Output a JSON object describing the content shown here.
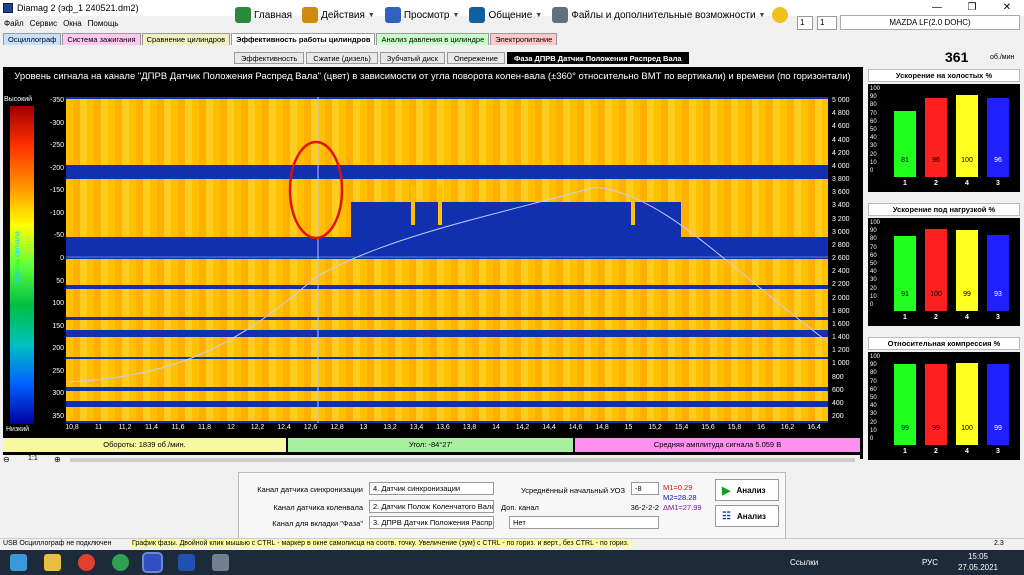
{
  "window": {
    "title": "Diamag 2 (эф_1 240521.dm2)"
  },
  "menu": [
    "Файл",
    "Сервис",
    "Окна",
    "Помощь"
  ],
  "toolbar": {
    "home": "Главная",
    "actions": "Действия",
    "view": "Просмотр",
    "comm": "Общение",
    "files": "Файлы и дополнительные возможности"
  },
  "spinners": {
    "a": "1",
    "b": "1"
  },
  "car": "MAZDA LF(2.0 DOHC)",
  "tabs": [
    "Осциллограф",
    "Система зажигания",
    "Сравнение цилиндров",
    "Эффективность работы цилиндров",
    "Анализ давления в цилиндре",
    "Электропитание"
  ],
  "subtabs": [
    "Эффективность",
    "Сжатие (дизель)",
    "Зубчатый диск",
    "Опережение",
    "Фаза ДПРВ Датчик Положения Распред Вала"
  ],
  "rpm": {
    "value": "361",
    "unit": "об./мин"
  },
  "plot": {
    "title": "Уровень сигнала на канале \"ДПРВ Датчик Положения Распред Вала\" (цвет) в зависимости от угла поворота колен-вала (±360° относительно ВМТ по вертикали) и времени (по горизонтали)",
    "colorbar_top": "Высокий",
    "colorbar_bottom": "Низкий",
    "colorbar_label": "Уровень сигнала",
    "y_left": [
      "-350",
      "-300",
      "-250",
      "-200",
      "-150",
      "-100",
      "-50",
      "0",
      "50",
      "100",
      "150",
      "200",
      "250",
      "300",
      "350"
    ],
    "y_right": [
      "5 000",
      "4 800",
      "4 600",
      "4 400",
      "4 200",
      "4 000",
      "3 800",
      "3 600",
      "3 400",
      "3 200",
      "3 000",
      "2 800",
      "2 600",
      "2 400",
      "2 200",
      "2 000",
      "1 800",
      "1 600",
      "1 400",
      "1 200",
      "1 000",
      "800",
      "600",
      "400",
      "200"
    ],
    "x": [
      "10,8",
      "11",
      "11,2",
      "11,4",
      "11,6",
      "11,8",
      "12",
      "12,2",
      "12,4",
      "12,6",
      "12,8",
      "13",
      "13,2",
      "13,4",
      "13,6",
      "13,8",
      "14",
      "14,2",
      "14,4",
      "14,6",
      "14,8",
      "15",
      "15,2",
      "15,4",
      "15,6",
      "15,8",
      "16",
      "16,2",
      "16,4"
    ]
  },
  "info": {
    "rpm": "Обороты: 1839 об./мин.",
    "angle": "Угол: -84°27'",
    "amp": "Средняя амплитуда сигнала 5.059 В"
  },
  "scale": "1:1",
  "controls": {
    "sync_label": "Канал датчика синхронизации",
    "sync_value": "4. Датчик синхронизации",
    "crank_label": "Канал датчика коленвала",
    "crank_value": "2. Датчик Полож Коленчатого Вала",
    "phase_label": "Канал для вкладки \"Фаза\"",
    "phase_value": "3. ДПРВ Датчик Положения Распр",
    "uoz_label": "Усреднённый начальный УОЗ",
    "uoz_value": "-8",
    "dop_label": "Доп. канал",
    "dop_code": "36-2-2-2",
    "dop_value": "Нет",
    "m1": "M1=0.29",
    "m2": "M2=28.28",
    "dm": "ΔM1=27.99",
    "analyze1": "Анализ",
    "analyze2": "Анализ"
  },
  "right": {
    "idle_title": "Ускорение на холостых %",
    "load_title": "Ускорение под нагрузкой %",
    "comp_title": "Относительная компрессия %",
    "yticks": [
      "100",
      "90",
      "80",
      "70",
      "60",
      "50",
      "40",
      "30",
      "20",
      "10",
      "0"
    ],
    "cylinders": [
      "1",
      "2",
      "4",
      "3"
    ],
    "colors": [
      "#20ff20",
      "#ff2020",
      "#ffff20",
      "#2020ff"
    ],
    "idle": [
      81,
      96,
      100,
      96
    ],
    "load": [
      91,
      100,
      99,
      93
    ],
    "comp": [
      99,
      99,
      100,
      99
    ]
  },
  "status": {
    "usb": "USB Осциллограф не подключен",
    "hint": "График фазы. Двойной клик мышью с CTRL - маркер в окне самописца на соотв. точку. Увеличение (зум) с CTRL - по гориз. и верт., без CTRL - по гориз.",
    "ver": "2.3"
  },
  "taskbar": {
    "links": "Ссылки",
    "lang": "РУС",
    "time": "15:05",
    "date": "27.05.2021"
  }
}
